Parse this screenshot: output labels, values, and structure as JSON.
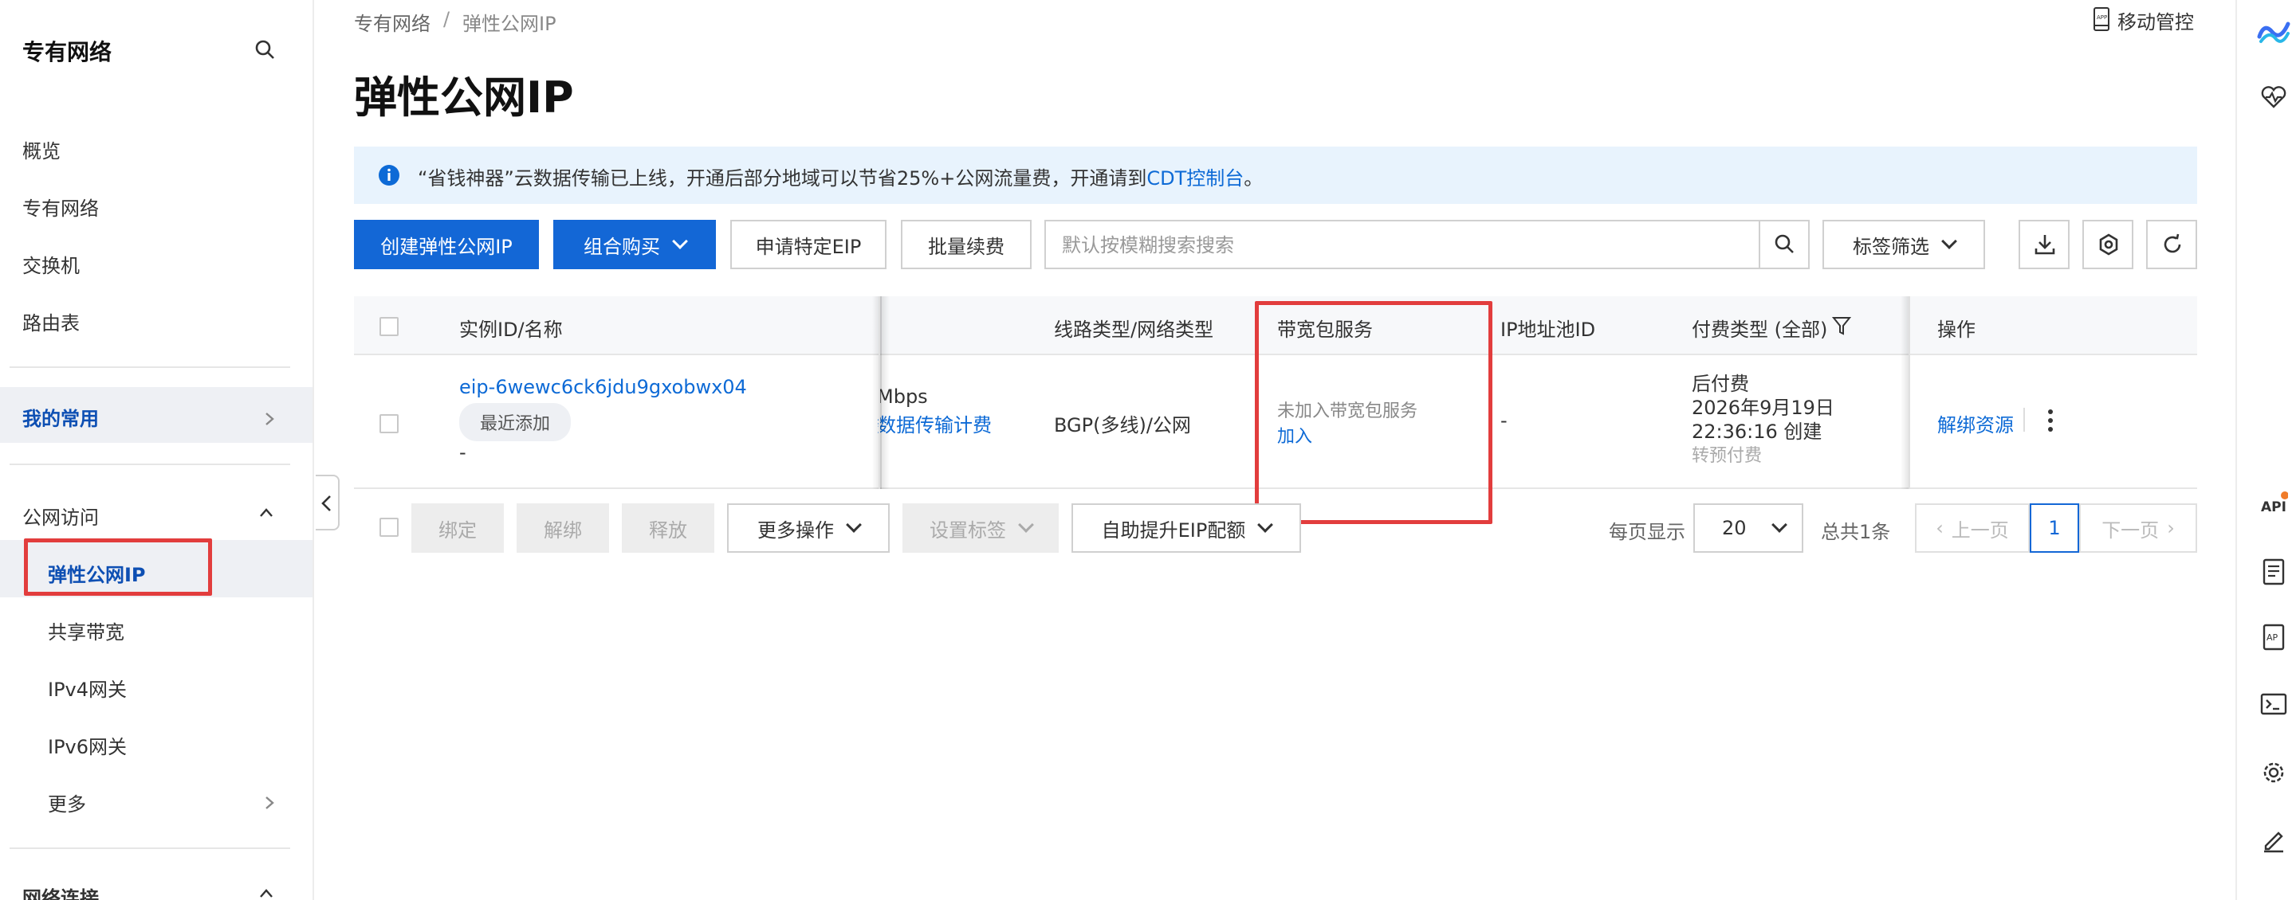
{
  "sidebar": {
    "title": "专有网络",
    "items": [
      "概览",
      "专有网络",
      "交换机",
      "路由表"
    ],
    "favorites": "我的常用",
    "section_public": "公网访问",
    "sub_items": [
      "弹性公网IP",
      "共享带宽",
      "IPv4网关",
      "IPv6网关",
      "更多"
    ],
    "section_next": "网络连接"
  },
  "header": {
    "breadcrumb": [
      "专有网络",
      "/",
      "弹性公网IP"
    ],
    "mobile_label": "移动管控",
    "title": "弹性公网IP"
  },
  "banner": {
    "text": "“省钱神器”云数据传输已上线，开通后部分地域可以节省25%+公网流量费，开通请到",
    "link": "CDT控制台",
    "suffix": "。"
  },
  "toolbar": {
    "create": "创建弹性公网IP",
    "combo": "组合购买",
    "apply": "申请特定EIP",
    "renew": "批量续费",
    "search_placeholder": "默认按模糊搜索搜索",
    "tag_filter": "标签筛选"
  },
  "table": {
    "headers": {
      "instance": "实例ID/名称",
      "line": "线路类型/网络类型",
      "bandwidth_pkg": "带宽包服务",
      "ip_pool": "IP地址池ID",
      "billing": "付费类型 (全部)",
      "ops": "操作"
    },
    "row": {
      "id": "eip-6wewc6ck6jdu9gxobwx04",
      "tag": "最近添加",
      "name": "-",
      "bw_partial": "Mbps",
      "bw_link": "数据传输计费",
      "line": "BGP(多线)/公网",
      "pkg_status": "未加入带宽包服务",
      "pkg_join": "加入",
      "ip_pool": "-",
      "billing_type": "后付费",
      "created_date": "2026年9月19日",
      "created_time": "22:36:16 创建",
      "convert": "转预付费",
      "unbind": "解绑资源"
    }
  },
  "footer": {
    "bind": "绑定",
    "unbind": "解绑",
    "release": "释放",
    "more_ops": "更多操作",
    "set_tags": "设置标签",
    "auto_quota": "自助提升EIP配额",
    "per_page_label": "每页显示",
    "per_page": "20",
    "total": "总共1条",
    "prev": "上一页",
    "page": "1",
    "next": "下一页"
  },
  "rightbar": {
    "api_label": "API"
  },
  "colors": {
    "primary": "#1367d6",
    "link": "#0d6ad6",
    "highlight": "#e23d3d",
    "banner_bg": "#e8f3fd"
  }
}
